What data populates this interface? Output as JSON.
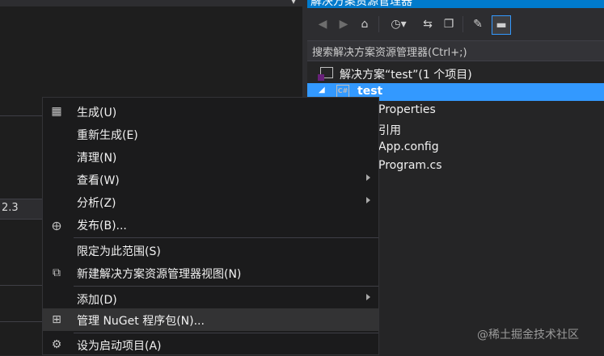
{
  "left_pane": {
    "partial_value": "2.3"
  },
  "solution_explorer": {
    "title": "解决方案资源管理器",
    "search_placeholder": "搜索解决方案资源管理器(Ctrl+;)",
    "tree": {
      "solution_label": "解决方案“test”(1 个项目)",
      "project_label": "test",
      "items": [
        "Properties",
        "引用",
        "App.config",
        "Program.cs"
      ]
    }
  },
  "context_menu": {
    "build": "生成(U)",
    "rebuild": "重新生成(E)",
    "clean": "清理(N)",
    "view": "查看(W)",
    "analyze": "分析(Z)",
    "publish": "发布(B)...",
    "scope_to_this": "限定为此范围(S)",
    "new_explorer_view": "新建解决方案资源管理器视图(N)",
    "add": "添加(D)",
    "manage_nuget": "管理 NuGet 程序包(N)...",
    "set_startup": "设为启动项目(A)"
  },
  "watermark": "@稀土掘金技术社区"
}
